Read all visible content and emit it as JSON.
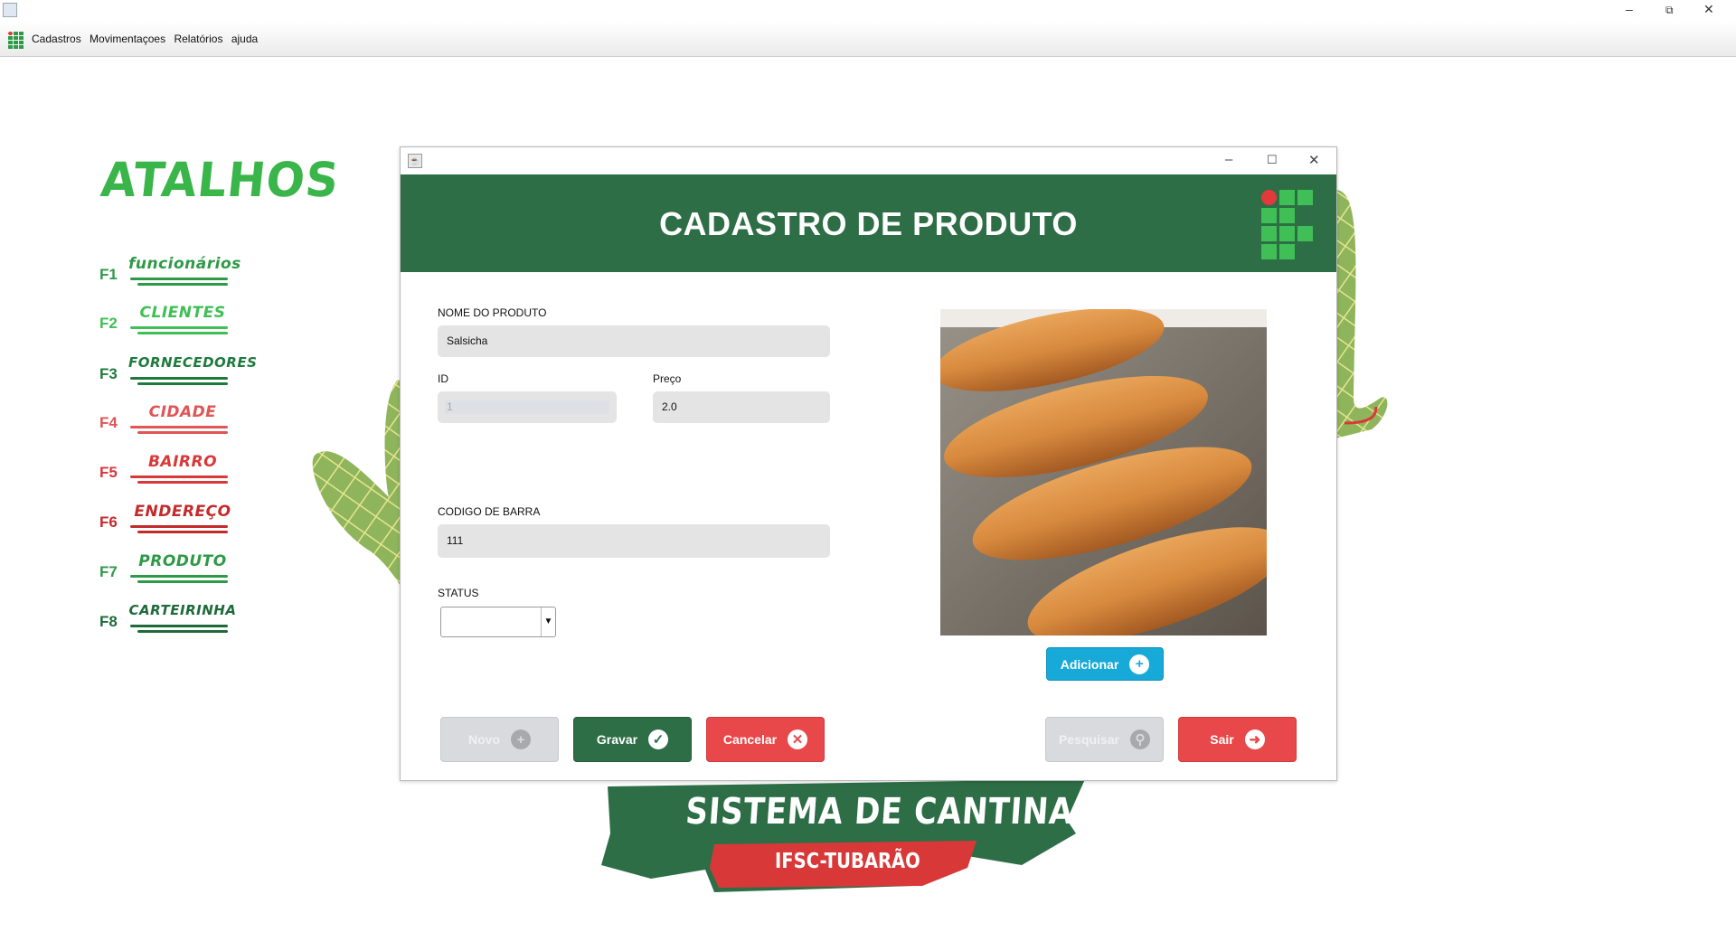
{
  "window": {
    "menu": [
      "Cadastros",
      "Movimentaçoes",
      "Relatórios",
      "ajuda"
    ],
    "controls": {
      "minimize": "–",
      "restore": "⧉",
      "close": "✕"
    }
  },
  "shortcuts": {
    "title": "ATALHOS",
    "items": [
      {
        "key": "F1",
        "label": "funcionários",
        "color": "#2e9a47"
      },
      {
        "key": "F2",
        "label": "CLIENTES",
        "color": "#3fbf55"
      },
      {
        "key": "F3",
        "label": "FORNECEDORES",
        "color": "#1f7a3d"
      },
      {
        "key": "F4",
        "label": "CIDADE",
        "color": "#e05555"
      },
      {
        "key": "F5",
        "label": "BAIRRO",
        "color": "#d93838"
      },
      {
        "key": "F6",
        "label": "ENDEREÇO",
        "color": "#c42a2a"
      },
      {
        "key": "F7",
        "label": "PRODUTO",
        "color": "#2e9a47"
      },
      {
        "key": "F8",
        "label": "CARTEIRINHA",
        "color": "#1f6a3a"
      }
    ]
  },
  "banner": {
    "line1": "SISTEMA DE CANTINA",
    "line2": "IFSC-TUBARÃO"
  },
  "form": {
    "frame_controls": {
      "minimize": "–",
      "maximize": "☐",
      "close": "✕"
    },
    "title": "CADASTRO DE PRODUTO",
    "labels": {
      "nome": "NOME DO PRODUTO",
      "id": "ID",
      "preco": "Preço",
      "codigo": "CODIGO DE BARRA",
      "status": "STATUS"
    },
    "values": {
      "nome": "Salsicha",
      "id": "1",
      "preco": "2.0",
      "codigo": "111",
      "status": ""
    },
    "buttons": {
      "adicionar": "Adicionar",
      "novo": "Novo",
      "gravar": "Gravar",
      "cancelar": "Cancelar",
      "pesquisar": "Pesquisar",
      "sair": "Sair"
    }
  },
  "colors": {
    "header_green": "#2e6e46",
    "accent_blue": "#17a9d8",
    "danger_red": "#e8484a",
    "disabled_gray": "#d9dade"
  }
}
